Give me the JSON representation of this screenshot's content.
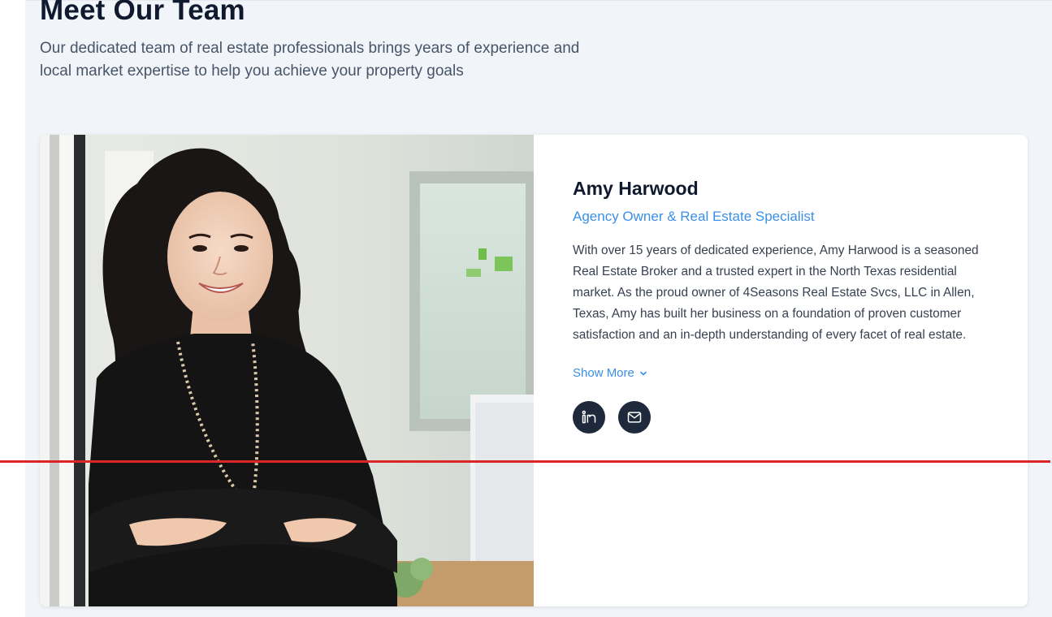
{
  "section": {
    "title": "Meet Our Team",
    "intro": "Our dedicated team of real estate professionals brings years of experience and local market expertise to help you achieve your property goals"
  },
  "member": {
    "name": "Amy Harwood",
    "role": "Agency Owner & Real Estate Specialist",
    "bio": "With over 15 years of dedicated experience, Amy Harwood is a seasoned Real Estate Broker and a trusted expert in the North Texas residential market. As the proud owner of 4Seasons Real Estate Svcs, LLC in Allen, Texas, Amy has built her business on a foundation of proven customer satisfaction and an in-depth understanding of every facet of real estate.",
    "show_more_label": "Show More",
    "show_more_icon": "chevron-down-icon",
    "socials": [
      {
        "icon": "linkedin-icon"
      },
      {
        "icon": "mail-icon"
      }
    ],
    "photo_alt": "Amy Harwood portrait"
  },
  "colors": {
    "accent": "#3b8fe6",
    "heading": "#0f1a2e",
    "social_bg": "#1e293b",
    "section_bg": "#f1f4f8",
    "overlay_line": "#dc2626"
  }
}
